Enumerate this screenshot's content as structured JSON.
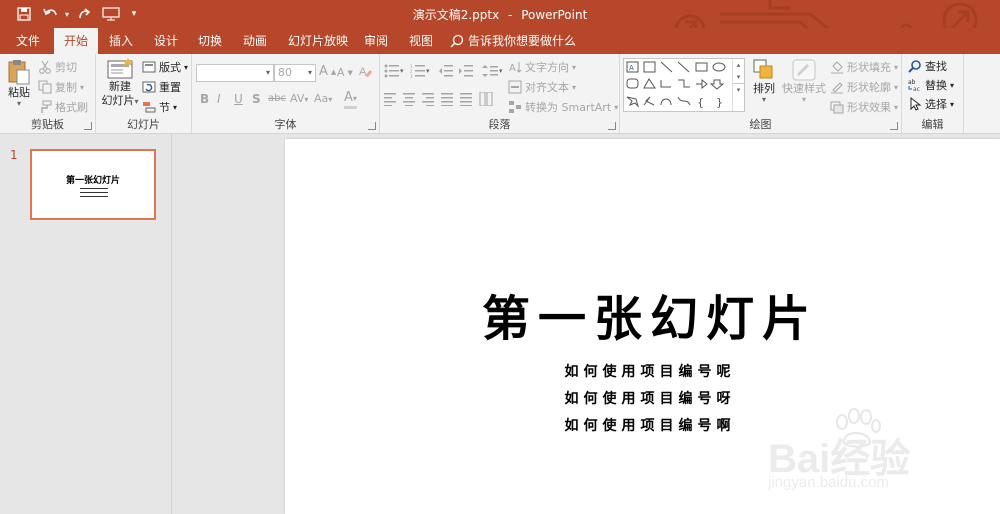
{
  "titlebar": {
    "doc_title": "演示文稿2.pptx",
    "separator": "-",
    "app_name": "PowerPoint",
    "bg_color": "#b7472a",
    "qat_icons": [
      "save-icon",
      "undo-icon",
      "redo-icon",
      "presenter-icon",
      "customize-qat-icon"
    ]
  },
  "tabs": [
    {
      "label": "文件",
      "active": false
    },
    {
      "label": "开始",
      "active": true
    },
    {
      "label": "插入",
      "active": false
    },
    {
      "label": "设计",
      "active": false
    },
    {
      "label": "切换",
      "active": false
    },
    {
      "label": "动画",
      "active": false
    },
    {
      "label": "幻灯片放映",
      "active": false
    },
    {
      "label": "审阅",
      "active": false
    },
    {
      "label": "视图",
      "active": false
    }
  ],
  "tell_me": "告诉我你想要做什么",
  "ribbon": {
    "clipboard": {
      "label": "剪贴板",
      "paste": "粘贴",
      "cut": "剪切",
      "copy": "复制",
      "format_painter": "格式刷"
    },
    "slides": {
      "label": "幻灯片",
      "new_slide_line1": "新建",
      "new_slide_line2": "幻灯片",
      "layout": "版式",
      "reset": "重置",
      "section": "节"
    },
    "font": {
      "label": "字体",
      "font_name": "",
      "font_size": "80",
      "bold": "B",
      "italic": "I",
      "underline": "U",
      "shadow": "S",
      "strikethrough": "abc",
      "spacing": "AV",
      "change_case": "Aa",
      "color": "A"
    },
    "paragraph": {
      "label": "段落",
      "text_direction": "文字方向",
      "align_text": "对齐文本",
      "smartart": "转换为 SmartArt"
    },
    "drawing": {
      "label": "绘图",
      "arrange": "排列",
      "quick_styles": "快速样式",
      "shape_fill": "形状填充",
      "shape_outline": "形状轮廓",
      "shape_effects": "形状效果"
    },
    "editing": {
      "label": "编辑",
      "find": "查找",
      "replace": "替换",
      "select": "选择"
    }
  },
  "thumbnail": {
    "number": "1",
    "title": "第一张幻灯片"
  },
  "slide": {
    "title": "第一张幻灯片",
    "lines": [
      "如何使用项目编号呢",
      "如何使用项目编号呀",
      "如何使用项目编号啊"
    ]
  },
  "watermark": {
    "text": "Bai经验",
    "url": "jingyan.baidu.com"
  }
}
